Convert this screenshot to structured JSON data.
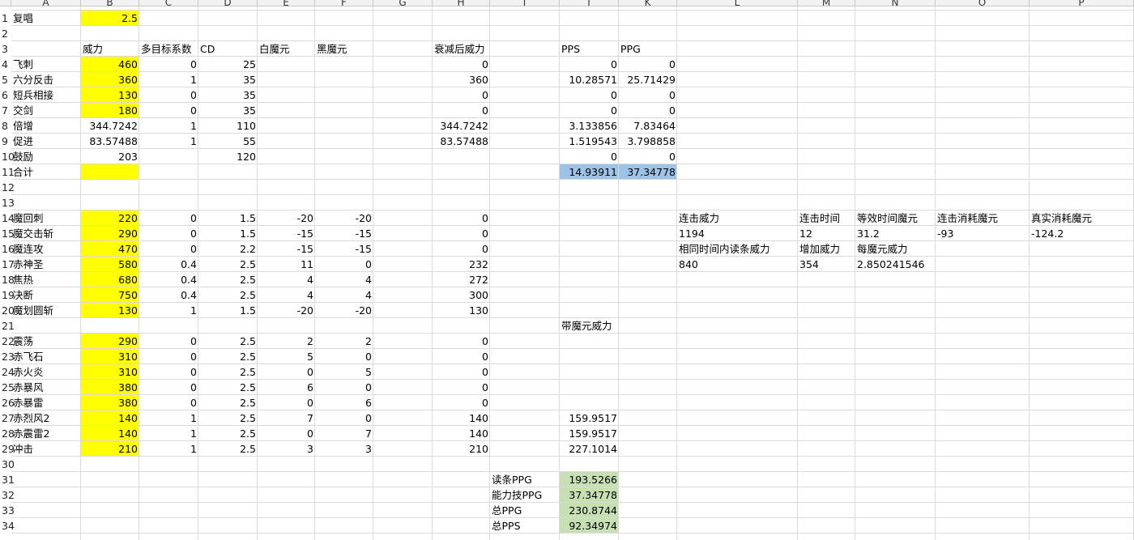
{
  "columns": [
    "A",
    "B",
    "C",
    "D",
    "E",
    "F",
    "G",
    "H",
    "I",
    "J",
    "K",
    "L",
    "M",
    "N",
    "O",
    "P"
  ],
  "rows": [
    "1",
    "2",
    "3",
    "4",
    "5",
    "6",
    "7",
    "8",
    "9",
    "10",
    "11",
    "12",
    "13",
    "14",
    "15",
    "16",
    "17",
    "18",
    "19",
    "20",
    "21",
    "22",
    "23",
    "24",
    "25",
    "26",
    "27",
    "28",
    "29",
    "30",
    "31",
    "32",
    "33",
    "34"
  ],
  "colors": {
    "yellow": "#ffff00",
    "blue": "#9dc3e6",
    "green": "#c6e0b4",
    "grid": "#dadada",
    "header_bg": "#f2f2f2"
  },
  "cells": {
    "A1": "复唱",
    "B1": "2.5",
    "B3": "威力",
    "C3": "多目标系数",
    "D3": "CD",
    "E3": "白魔元",
    "F3": "黑魔元",
    "H3": "衰减后威力",
    "J3": "PPS",
    "K3": "PPG",
    "A4": "飞刺",
    "B4": "460",
    "C4": "0",
    "D4": "25",
    "H4": "0",
    "J4": "0",
    "K4": "0",
    "A5": "六分反击",
    "B5": "360",
    "C5": "1",
    "D5": "35",
    "H5": "360",
    "J5": "10.28571",
    "K5": "25.71429",
    "A6": "短兵相接",
    "B6": "130",
    "C6": "0",
    "D6": "35",
    "H6": "0",
    "J6": "0",
    "K6": "0",
    "A7": "交剑",
    "B7": "180",
    "C7": "0",
    "D7": "35",
    "H7": "0",
    "J7": "0",
    "K7": "0",
    "A8": "倍增",
    "B8": "344.7242",
    "C8": "1",
    "D8": "110",
    "H8": "344.7242",
    "J8": "3.133856",
    "K8": "7.83464",
    "A9": "促进",
    "B9": "83.57488",
    "C9": "1",
    "D9": "55",
    "H9": "83.57488",
    "J9": "1.519543",
    "K9": "3.798858",
    "A10": "鼓励",
    "B10": "203",
    "D10": "120",
    "J10": "0",
    "K10": "0",
    "A11": "合计",
    "J11": "14.93911",
    "K11": "37.34778",
    "A14": "魔回刺",
    "B14": "220",
    "C14": "0",
    "D14": "1.5",
    "E14": "-20",
    "F14": "-20",
    "H14": "0",
    "A15": "魔交击斩",
    "B15": "290",
    "C15": "0",
    "D15": "1.5",
    "E15": "-15",
    "F15": "-15",
    "H15": "0",
    "A16": "魔连攻",
    "B16": "470",
    "C16": "0",
    "D16": "2.2",
    "E16": "-15",
    "F16": "-15",
    "H16": "0",
    "A17": "赤神圣",
    "B17": "580",
    "C17": "0.4",
    "D17": "2.5",
    "E17": "11",
    "F17": "0",
    "H17": "232",
    "A18": "焦热",
    "B18": "680",
    "C18": "0.4",
    "D18": "2.5",
    "E18": "4",
    "F18": "4",
    "H18": "272",
    "A19": "决断",
    "B19": "750",
    "C19": "0.4",
    "D19": "2.5",
    "E19": "4",
    "F19": "4",
    "H19": "300",
    "A20": "魔划圆斩",
    "B20": "130",
    "C20": "1",
    "D20": "1.5",
    "E20": "-20",
    "F20": "-20",
    "H20": "130",
    "J21": "带魔元威力",
    "A22": "震荡",
    "B22": "290",
    "C22": "0",
    "D22": "2.5",
    "E22": "2",
    "F22": "2",
    "H22": "0",
    "A23": "赤飞石",
    "B23": "310",
    "C23": "0",
    "D23": "2.5",
    "E23": "5",
    "F23": "0",
    "H23": "0",
    "A24": "赤火炎",
    "B24": "310",
    "C24": "0",
    "D24": "2.5",
    "E24": "0",
    "F24": "5",
    "H24": "0",
    "A25": "赤暴风",
    "B25": "380",
    "C25": "0",
    "D25": "2.5",
    "E25": "6",
    "F25": "0",
    "H25": "0",
    "A26": "赤暴雷",
    "B26": "380",
    "C26": "0",
    "D26": "2.5",
    "E26": "0",
    "F26": "6",
    "H26": "0",
    "A27": "赤烈风2",
    "B27": "140",
    "C27": "1",
    "D27": "2.5",
    "E27": "7",
    "F27": "0",
    "H27": "140",
    "J27": "159.9517",
    "A28": "赤震雷2",
    "B28": "140",
    "C28": "1",
    "D28": "2.5",
    "E28": "0",
    "F28": "7",
    "H28": "140",
    "J28": "159.9517",
    "A29": "冲击",
    "B29": "210",
    "C29": "1",
    "D29": "2.5",
    "E29": "3",
    "F29": "3",
    "H29": "210",
    "J29": "227.1014",
    "I31": "读条PPG",
    "J31": "193.5266",
    "I32": "能力技PPG",
    "J32": "37.34778",
    "I33": "总PPG",
    "J33": "230.8744",
    "I34": "总PPS",
    "J34": "92.34974",
    "L14": "连击威力",
    "M14": "连击时间",
    "N14": "等效时间魔元",
    "O14": "连击消耗魔元",
    "P14": "真实消耗魔元",
    "L15": "1194",
    "M15": "12",
    "N15": "31.2",
    "O15": "-93",
    "P15": "-124.2",
    "L16": "相同时间内读条威力",
    "M16": "增加威力",
    "N16": "每魔元威力",
    "L17": "840",
    "M17": "354",
    "N17": "2.850241546"
  }
}
